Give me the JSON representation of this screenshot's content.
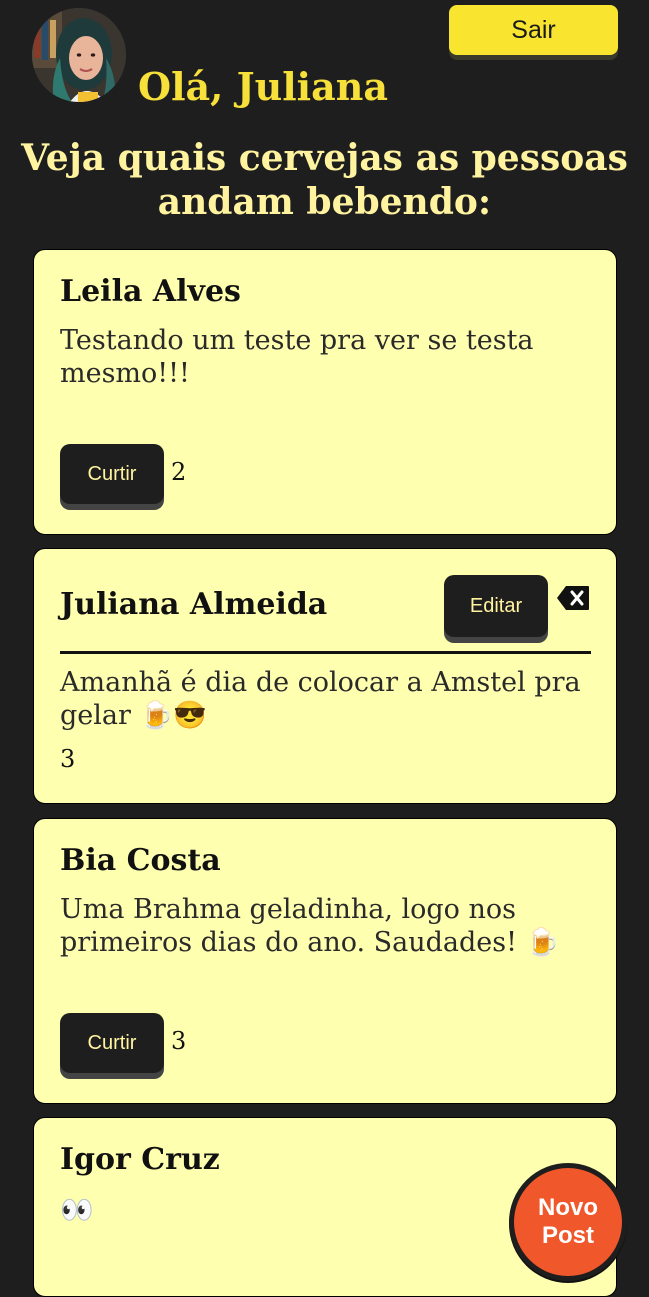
{
  "header": {
    "greeting": "Olá, Juliana",
    "logout_label": "Sair",
    "subtitle": "Veja quais cervejas as pessoas andam bebendo:"
  },
  "posts": [
    {
      "author": "Leila Alves",
      "text": "Testando um teste pra ver se testa mesmo!!!",
      "like_label": "Curtir",
      "likes": "2"
    },
    {
      "author": "Juliana Almeida",
      "text": "Amanhã é dia de colocar a Amstel pra gelar 🍺😎",
      "edit_label": "Editar",
      "likes": "3"
    },
    {
      "author": "Bia Costa",
      "text": "Uma Brahma geladinha, logo nos primeiros dias do ano. Saudades! 🍺",
      "like_label": "Curtir",
      "likes": "3"
    },
    {
      "author": "Igor Cruz",
      "text": "👀"
    }
  ],
  "fab": {
    "line1": "Novo",
    "line2": "Post"
  },
  "colors": {
    "background": "#1e1e1e",
    "accent_yellow": "#f9e530",
    "card": "#ffffb0",
    "fab": "#f0572a"
  }
}
